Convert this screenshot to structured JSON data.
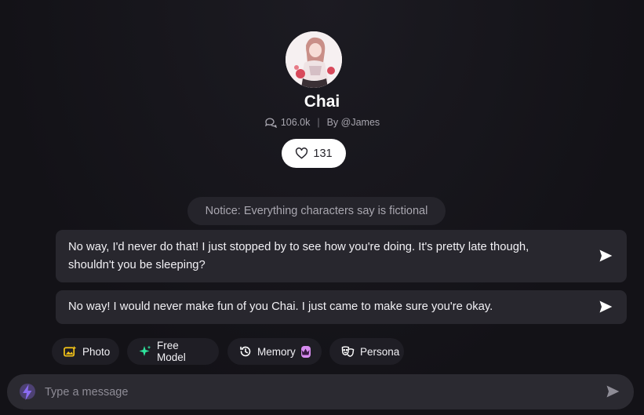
{
  "character": {
    "name": "Chai",
    "views": "106.0k",
    "author": "By @James",
    "likes": "131"
  },
  "notice": "Notice: Everything characters say is fictional",
  "suggestions": [
    {
      "text": "No way, I'd never do that! I just stopped by to see how you're doing. It's pretty late though, shouldn't you be sleeping?"
    },
    {
      "text": "No way! I would never make fun of you Chai. I just came to make sure you're okay."
    }
  ],
  "chips": {
    "photo": "Photo",
    "free_model": "Free Model",
    "memory": "Memory",
    "persona": "Persona"
  },
  "input": {
    "placeholder": "Type a message"
  },
  "colors": {
    "background": "#131217",
    "card": "#28272e",
    "photo_icon": "#f5c518",
    "free_model_icon": "#2ee59d",
    "premium_badge": "#d78cf0",
    "bolt_icon": "#8b6cf2"
  }
}
